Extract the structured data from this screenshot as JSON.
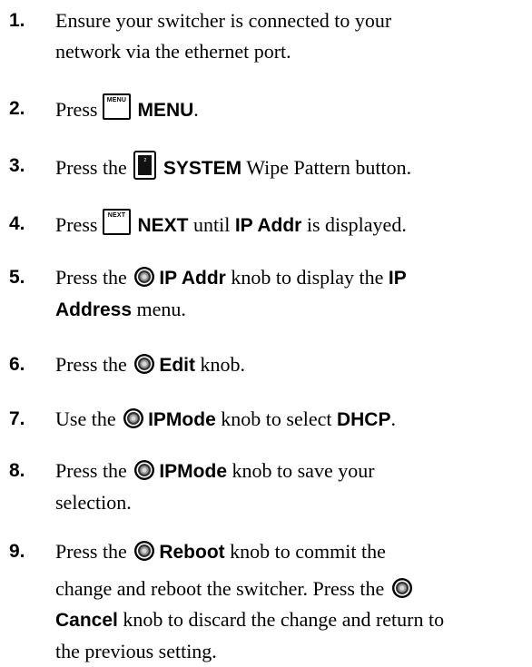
{
  "steps": [
    {
      "number": "1.",
      "line1": "Ensure your switcher is connected to your",
      "line2": "network via the ethernet port."
    },
    {
      "number": "2.",
      "press": "Press",
      "key_label": "MENU",
      "bold": "MENU",
      "tail": "."
    },
    {
      "number": "3.",
      "press": "Press the",
      "button_number": "2",
      "bold": "SYSTEM",
      "tail": " Wipe Pattern button."
    },
    {
      "number": "4.",
      "press": "Press",
      "key_label": "NEXT",
      "bold": "NEXT",
      "mid": " until ",
      "bold2": "IP Addr",
      "tail": " is displayed."
    },
    {
      "number": "5.",
      "press": "Press the",
      "bold": "IP Addr",
      "mid": " knob to display the ",
      "bold2a": "IP",
      "bold2b": "Address",
      "tail": " menu."
    },
    {
      "number": "6.",
      "press": "Press the",
      "bold": "Edit",
      "tail": " knob."
    },
    {
      "number": "7.",
      "press": "Use the",
      "bold": "IPMode",
      "mid": " knob to select ",
      "bold2": "DHCP",
      "tail": "."
    },
    {
      "number": "8.",
      "press": "Press the",
      "bold": "IPMode",
      "mid": " knob to save your",
      "line2": "selection."
    },
    {
      "number": "9.",
      "press": "Press the",
      "bold": "Reboot",
      "mid": " knob to commit the",
      "line2": "change and reboot the switcher. Press the",
      "bold2": "Cancel",
      "line3_tail": " knob to discard the change and return to",
      "line4": "the previous setting."
    }
  ]
}
